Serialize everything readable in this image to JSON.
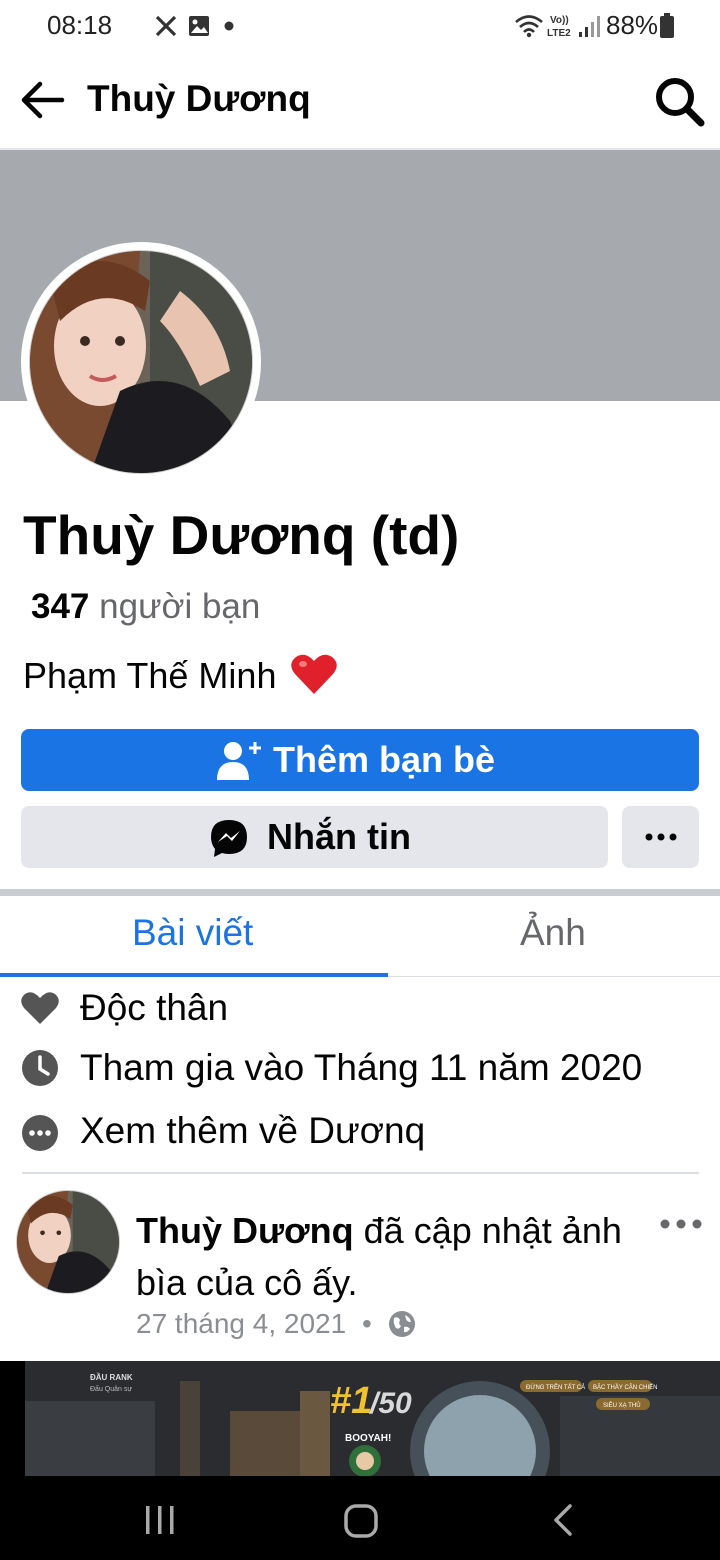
{
  "status_bar": {
    "time": "08:18",
    "battery": "88%",
    "icons": [
      "x-logo-icon",
      "image-icon",
      "dot-icon",
      "wifi-icon",
      "volte-icon",
      "signal-icon",
      "battery-icon"
    ]
  },
  "header": {
    "title": "Thuỳ Dươnq"
  },
  "profile": {
    "name": "Thuỳ Dươnq (td)",
    "friends_count": "347",
    "friends_label": "người bạn",
    "bio": "Phạm Thế Minh",
    "bio_emoji": "heart-emoji"
  },
  "actions": {
    "add_friend": "Thêm bạn bè",
    "message": "Nhắn tin",
    "more": "more-icon"
  },
  "tabs": [
    {
      "label": "Bài viết",
      "active": true
    },
    {
      "label": "Ảnh",
      "active": false
    }
  ],
  "about": [
    {
      "icon": "heart-icon",
      "text": "Độc thân"
    },
    {
      "icon": "clock-icon",
      "text": "Tham gia vào Tháng 11 năm 2020"
    },
    {
      "icon": "more-dots-icon",
      "text": "Xem thêm về Dươnq"
    }
  ],
  "post": {
    "author": "Thuỳ Dươnq",
    "action_text": " đã cập nhật ảnh bìa của cô ấy.",
    "date": "27 tháng 4, 2021",
    "separator": "•",
    "privacy_icon": "globe-icon",
    "image_texts": {
      "rank_title": "ĐẦU RANK",
      "rank_sub": "Đấu Quân sự",
      "rank": "#1",
      "rank_total": "/50",
      "booyah": "BOOYAH!",
      "badges": [
        "ĐỨNG TRÊN TẤT CẢ",
        "BẬC THẦY CẬN CHIẾN",
        "SIÊU XẠ THỦ"
      ]
    }
  },
  "colors": {
    "accent": "#1b74e4",
    "secondary_button": "#e4e6eb",
    "cover": "#a6a9ad",
    "muted_text": "#65676b"
  }
}
